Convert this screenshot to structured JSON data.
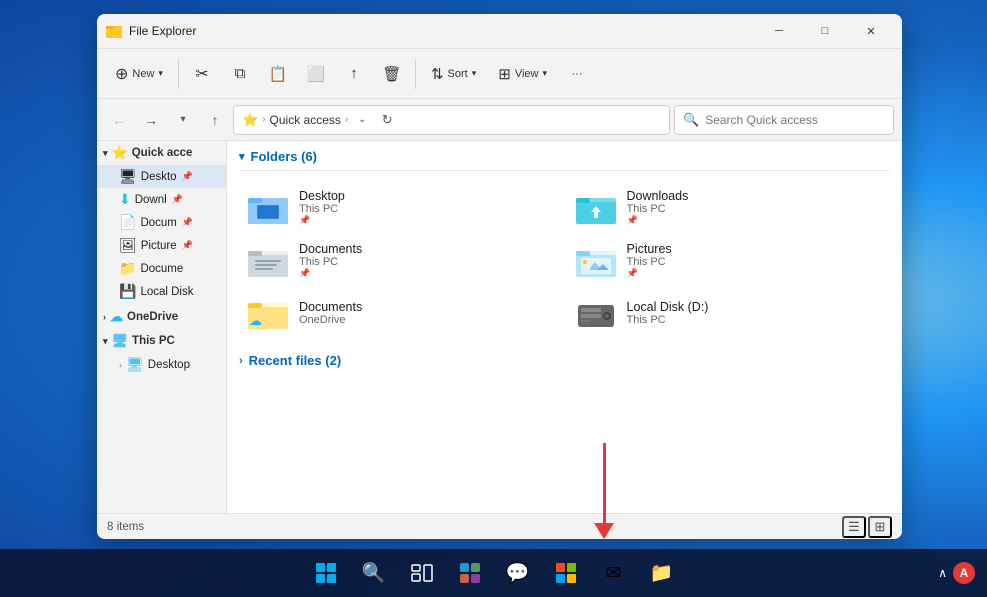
{
  "window": {
    "title": "File Explorer",
    "titlebar_icon": "📁"
  },
  "toolbar": {
    "new_label": "New",
    "new_chevron": "▾",
    "sort_label": "Sort",
    "sort_chevron": "▾",
    "view_label": "View",
    "view_chevron": "▾",
    "more_label": "···"
  },
  "addressbar": {
    "breadcrumb_icon": "⭐",
    "breadcrumb_label": "Quick access",
    "breadcrumb_chevron": "›",
    "dropdown_arrow": "⌄",
    "refresh_icon": "↻",
    "search_placeholder": "Search Quick access",
    "search_icon": "🔍"
  },
  "sidebar": {
    "quick_access_chevron": "▾",
    "quick_access_icon": "⭐",
    "quick_access_label": "Quick acce",
    "items": [
      {
        "icon": "🖥",
        "label": "Deskto",
        "pin": "📌",
        "active": true
      },
      {
        "icon": "⬇",
        "label": "Downl",
        "pin": "📌",
        "active": false
      },
      {
        "icon": "📄",
        "label": "Docum",
        "pin": "📌",
        "active": false
      },
      {
        "icon": "🖼",
        "label": "Picture",
        "pin": "📌",
        "active": false
      },
      {
        "icon": "📁",
        "label": "Docume",
        "pin": "",
        "active": false
      },
      {
        "icon": "💾",
        "label": "Local Disk",
        "pin": "",
        "active": false
      }
    ],
    "onedrive_label": "OneDrive",
    "thispc_label": "This PC",
    "thispc_items": [
      {
        "icon": "🖥",
        "label": "Desktop",
        "active": false
      }
    ]
  },
  "content": {
    "folders_header": "Folders (6)",
    "folders": [
      {
        "name": "Desktop",
        "sub": "This PC",
        "pinned": true,
        "icon_type": "desktop"
      },
      {
        "name": "Downloads",
        "sub": "This PC",
        "pinned": true,
        "icon_type": "downloads"
      },
      {
        "name": "Documents",
        "sub": "This PC",
        "pinned": true,
        "icon_type": "documents"
      },
      {
        "name": "Pictures",
        "sub": "This PC",
        "pinned": true,
        "icon_type": "pictures"
      },
      {
        "name": "Documents",
        "sub": "OneDrive",
        "pinned": false,
        "icon_type": "onedrive"
      },
      {
        "name": "Local Disk (D:)",
        "sub": "This PC",
        "pinned": false,
        "icon_type": "disk"
      }
    ],
    "recent_header": "Recent files (2)"
  },
  "statusbar": {
    "items_count": "8 items"
  },
  "taskbar": {
    "items": [
      {
        "icon": "⊞",
        "name": "start-button",
        "unicode": "⊞"
      },
      {
        "icon": "🔍",
        "name": "search-button"
      },
      {
        "icon": "▣",
        "name": "task-view-button"
      },
      {
        "icon": "⧉",
        "name": "widgets-button"
      },
      {
        "icon": "💬",
        "name": "chat-button"
      },
      {
        "icon": "⊞",
        "name": "store-button"
      },
      {
        "icon": "✉",
        "name": "mail-button"
      },
      {
        "icon": "📁",
        "name": "file-explorer-button"
      }
    ]
  }
}
